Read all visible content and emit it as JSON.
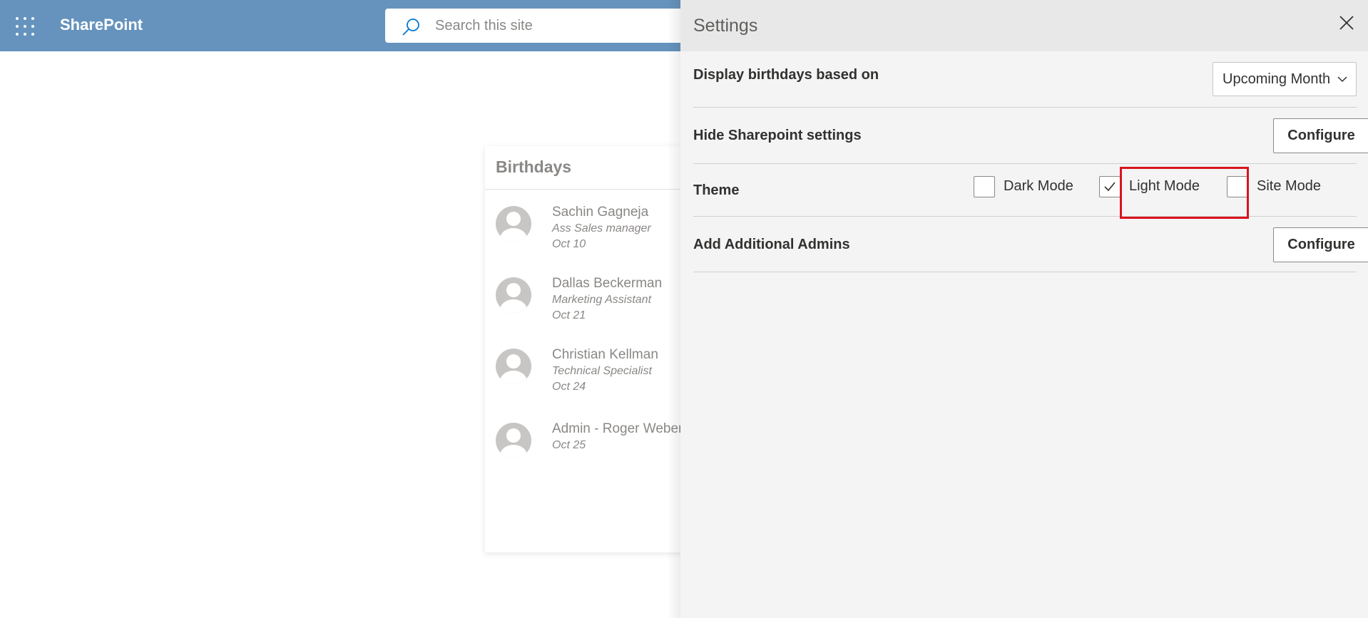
{
  "app": {
    "brand": "SharePoint"
  },
  "search": {
    "placeholder": "Search this site",
    "icon": "search-icon"
  },
  "card": {
    "title": "Birthdays",
    "people": [
      {
        "name": "Sachin Gagneja",
        "role": "Ass Sales manager",
        "date": "Oct 10"
      },
      {
        "name": "Dallas Beckerman",
        "role": "Marketing Assistant",
        "date": "Oct 21"
      },
      {
        "name": "Christian Kellman",
        "role": "Technical Specialist",
        "date": "Oct 24"
      },
      {
        "name": "Admin - Roger Weber",
        "role": "",
        "date": "Oct 25"
      }
    ]
  },
  "settings": {
    "title": "Settings",
    "birthdays": {
      "label": "Display birthdays based on",
      "selected": "Upcoming Month"
    },
    "hide_settings": {
      "label": "Hide Sharepoint settings",
      "button": "Configure"
    },
    "theme": {
      "label": "Theme",
      "options": [
        {
          "label": "Dark Mode",
          "checked": false
        },
        {
          "label": "Light Mode",
          "checked": true
        },
        {
          "label": "Site Mode",
          "checked": false
        }
      ]
    },
    "admins": {
      "label": "Add Additional Admins",
      "button": "Configure"
    }
  },
  "colors": {
    "header": "#6593bd",
    "highlight": "#d9141e",
    "panel": "#f4f4f4"
  }
}
